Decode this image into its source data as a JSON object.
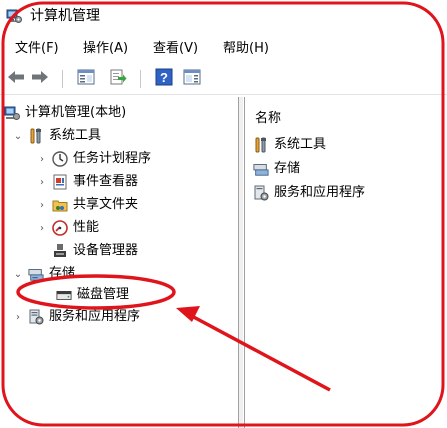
{
  "window": {
    "title": "计算机管理"
  },
  "menu": [
    "文件(F)",
    "操作(A)",
    "查看(V)",
    "帮助(H)"
  ],
  "toolbar": {
    "buttons": [
      {
        "name": "back-button",
        "icon": "arrow-left-icon"
      },
      {
        "name": "forward-button",
        "icon": "arrow-right-icon"
      },
      {
        "name": "show-hide-console-tree-button",
        "icon": "console-tree-icon"
      },
      {
        "name": "export-list-button",
        "icon": "export-list-icon"
      },
      {
        "name": "help-button",
        "icon": "help-icon"
      },
      {
        "name": "show-hide-action-pane-button",
        "icon": "action-pane-icon"
      }
    ]
  },
  "tree": {
    "root": "计算机管理(本地)",
    "system_tools": "系统工具",
    "task_scheduler": "任务计划程序",
    "event_viewer": "事件查看器",
    "shared_folders": "共享文件夹",
    "performance": "性能",
    "device_manager": "设备管理器",
    "storage": "存储",
    "disk_management": "磁盘管理",
    "services_apps": "服务和应用程序"
  },
  "content": {
    "column_header": "名称",
    "items": [
      "系统工具",
      "存储",
      "服务和应用程序"
    ]
  },
  "colors": {
    "annotation": "#e0141b"
  }
}
